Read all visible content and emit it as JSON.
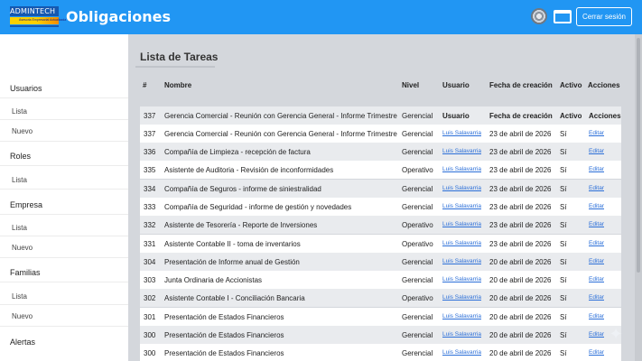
{
  "header": {
    "logo_text": "ADMINTECH",
    "logo_subtext": "Asesoria Empresarial Actualizada",
    "title": "Obligaciones",
    "icons": [
      "gear-icon",
      "window-icon"
    ],
    "logout_label": "Cerrar sesión",
    "color": "#2196f3"
  },
  "sidebar": {
    "sections": [
      {
        "title": "Usuarios",
        "items": [
          "Lista",
          "Nuevo"
        ]
      },
      {
        "title": "Roles",
        "items": [
          "Lista"
        ]
      },
      {
        "title": "Empresa",
        "items": [
          "Lista",
          "Nuevo"
        ]
      },
      {
        "title": "Familias",
        "items": [
          "Lista",
          "Nuevo"
        ]
      },
      {
        "title": "Alertas",
        "items": []
      }
    ]
  },
  "main": {
    "title": "Lista de Tareas",
    "columns": [
      "#",
      "Nombre",
      "Nivel",
      "Usuario",
      "Fecha de creación",
      "Activo",
      "Acciones"
    ],
    "rows": [
      {
        "id": "337",
        "name": "Gerencia Comercial - Reunión con Gerencia General - Informe Trimestre",
        "level": "Gerencial",
        "user": "Usuario",
        "date": "Fecha de creación",
        "active": "Activo",
        "action": "Acciones"
      },
      {
        "id": "337",
        "name": "Gerencia Comercial - Reunión con Gerencia General - Informe Trimestre",
        "level": "Gerencial",
        "user": "Luis Salavarria",
        "date": "23 de abril de 2026",
        "active": "Sí",
        "action": "Editar"
      },
      {
        "id": "336",
        "name": "Compañía de Limpieza - recepción de factura",
        "level": "Gerencial",
        "user": "Luis Salavarria",
        "date": "23 de abril de 2026",
        "active": "Sí",
        "action": "Editar"
      },
      {
        "id": "335",
        "name": "Asistente de Auditoria - Revisión de inconformidades",
        "level": "Operativo",
        "user": "Luis Salavarria",
        "date": "23 de abril de 2026",
        "active": "Sí",
        "action": "Editar"
      },
      {
        "id": "334",
        "name": "Compañía de Seguros - informe de siniestralidad",
        "level": "Gerencial",
        "user": "Luis Salavarria",
        "date": "23 de abril de 2026",
        "active": "Sí",
        "action": "Editar"
      },
      {
        "id": "333",
        "name": "Compañía de Seguridad - informe de gestión y novedades",
        "level": "Gerencial",
        "user": "Luis Salavarria",
        "date": "23 de abril de 2026",
        "active": "Sí",
        "action": "Editar"
      },
      {
        "id": "332",
        "name": "Asistente de Tesorería - Reporte de Inversiones",
        "level": "Operativo",
        "user": "Luis Salavarria",
        "date": "23 de abril de 2026",
        "active": "Sí",
        "action": "Editar"
      },
      {
        "id": "331",
        "name": "Asistente Contable II - toma de inventarios",
        "level": "Operativo",
        "user": "Luis Salavarria",
        "date": "23 de abril de 2026",
        "active": "Sí",
        "action": "Editar"
      },
      {
        "id": "304",
        "name": "Presentación de Informe anual de Gestión",
        "level": "Gerencial",
        "user": "Luis Salavarria",
        "date": "20 de abril de 2026",
        "active": "Sí",
        "action": "Editar"
      },
      {
        "id": "303",
        "name": "Junta Ordinaria de Accionistas",
        "level": "Gerencial",
        "user": "Luis Salavarria",
        "date": "20 de abril de 2026",
        "active": "Sí",
        "action": "Editar"
      },
      {
        "id": "302",
        "name": "Asistente Contable I - Conciliación Bancaria",
        "level": "Operativo",
        "user": "Luis Salavarria",
        "date": "20 de abril de 2026",
        "active": "Sí",
        "action": "Editar"
      },
      {
        "id": "301",
        "name": "Presentación de Estados Financieros",
        "level": "Gerencial",
        "user": "Luis Salavarria",
        "date": "20 de abril de 2026",
        "active": "Sí",
        "action": "Editar"
      },
      {
        "id": "300",
        "name": "Presentación de Estados Financieros",
        "level": "Gerencial",
        "user": "Luis Salavarria",
        "date": "20 de abril de 2026",
        "active": "Sí",
        "action": "Editar"
      },
      {
        "id": "300",
        "name": "Presentación de Estados Financieros",
        "level": "Gerencial",
        "user": "Luis Salavarria",
        "date": "20 de abril de 2026",
        "active": "Sí",
        "action": "Editar"
      }
    ]
  }
}
